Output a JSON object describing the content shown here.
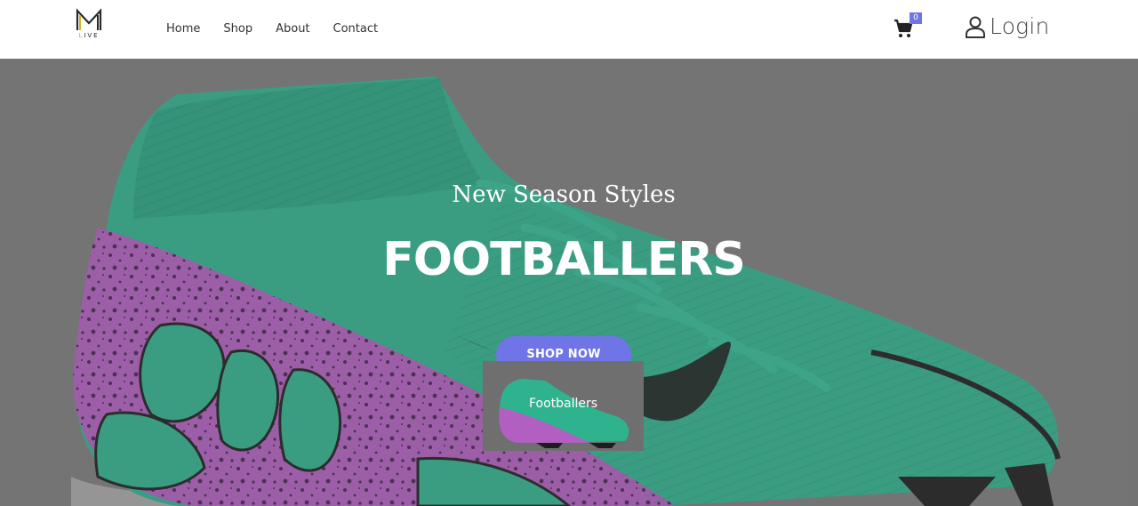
{
  "header": {
    "logo": {
      "letter": "M",
      "sub_a": "L",
      "sub_b": "IVE"
    },
    "nav": [
      {
        "label": "Home"
      },
      {
        "label": "Shop"
      },
      {
        "label": "About"
      },
      {
        "label": "Contact"
      }
    ],
    "cart": {
      "icon": "cart-icon",
      "count": "0",
      "badge_color": "#6f74e6"
    },
    "login": {
      "icon": "user-icon",
      "label": "Login"
    }
  },
  "hero": {
    "subtitle": "New Season Styles",
    "title": "FOOTBALLERS",
    "cta": "SHOP NOW",
    "thumbnail_label": "Footballers",
    "image": "football-boot-image",
    "colors": {
      "accent": "#6f74e6",
      "boot_teal": "#2fb38f",
      "boot_purple": "#b15fc0"
    }
  }
}
